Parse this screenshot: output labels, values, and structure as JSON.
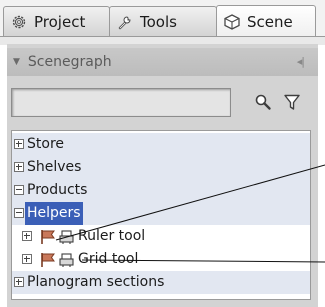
{
  "tabs": [
    {
      "label": "Project",
      "icon": "gear-icon"
    },
    {
      "label": "Tools",
      "icon": "wrench-icon"
    },
    {
      "label": "Scene",
      "icon": "cube-icon",
      "active": true
    }
  ],
  "panel": {
    "title": "Scenegraph",
    "collapse_icon": "collapse-icon",
    "search": {
      "value": "",
      "placeholder": ""
    },
    "search_icon": "magnifier-icon",
    "filter_icon": "filter-icon"
  },
  "tree": {
    "items": [
      {
        "label": "Store",
        "expanded": false
      },
      {
        "label": "Shelves",
        "expanded": false
      },
      {
        "label": "Products",
        "expanded": true
      },
      {
        "label": "Helpers",
        "expanded": true,
        "selected": true
      },
      {
        "label": "Ruler tool",
        "expanded": false,
        "icons": [
          "flag-icon",
          "tool-icon"
        ]
      },
      {
        "label": "Grid tool",
        "expanded": false,
        "icons": [
          "flag-icon",
          "tool-icon"
        ]
      },
      {
        "label": "Planogram sections",
        "expanded": false
      }
    ]
  },
  "colors": {
    "selection": "#3b5fb7",
    "alt_row": "#e2e7f1",
    "panel_bg": "#d3d3d3"
  }
}
